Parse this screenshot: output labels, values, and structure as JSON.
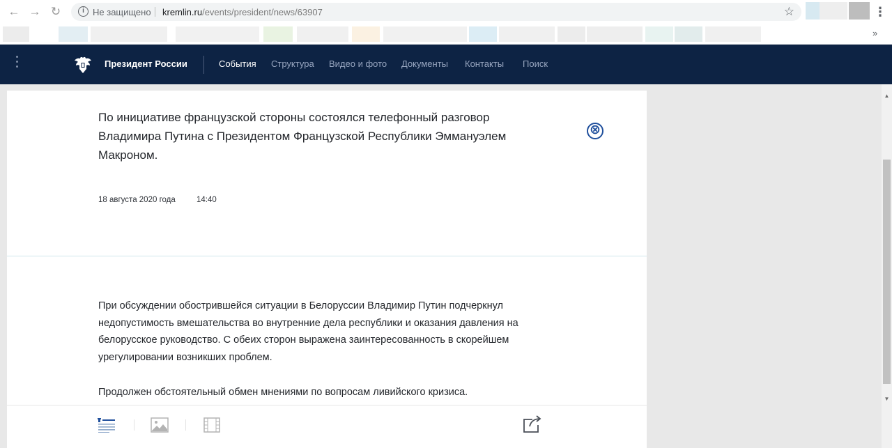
{
  "browser": {
    "back": "←",
    "forward": "→",
    "reload": "↻",
    "security_label": "Не защищено",
    "url_host": "kremlin.ru",
    "url_path": "/events/president/news/63907",
    "bookmarks_more": "»",
    "menu": "⋮"
  },
  "site": {
    "title": "Президент России",
    "nav": [
      "События",
      "Структура",
      "Видео и фото",
      "Документы",
      "Контакты",
      "Поиск"
    ],
    "active_nav": "События"
  },
  "article": {
    "lead": "По инициативе французской стороны состоялся телефонный разговор Владимира Путина с Президентом Французской Республики Эммануэлем Макроном.",
    "date": "18 августа 2020 года",
    "time": "14:40",
    "paragraphs": [
      "При обсуждении обострившейся ситуации в Белоруссии Владимир Путин подчеркнул недопустимость вмешательства во внутренние дела республики и оказания давления на белорусское руководство. С обеих сторон выражена заинтересованность в скорейшем урегулировании возникших проблем.",
      "Продолжен обстоятельный обмен мнениями по вопросам ливийского кризиса."
    ]
  },
  "icons": {
    "close": "⊗",
    "star": "☆",
    "info": "i"
  },
  "colors": {
    "header_bg": "#0d2344",
    "accent": "#1f4f9c",
    "text": "#23262b"
  }
}
